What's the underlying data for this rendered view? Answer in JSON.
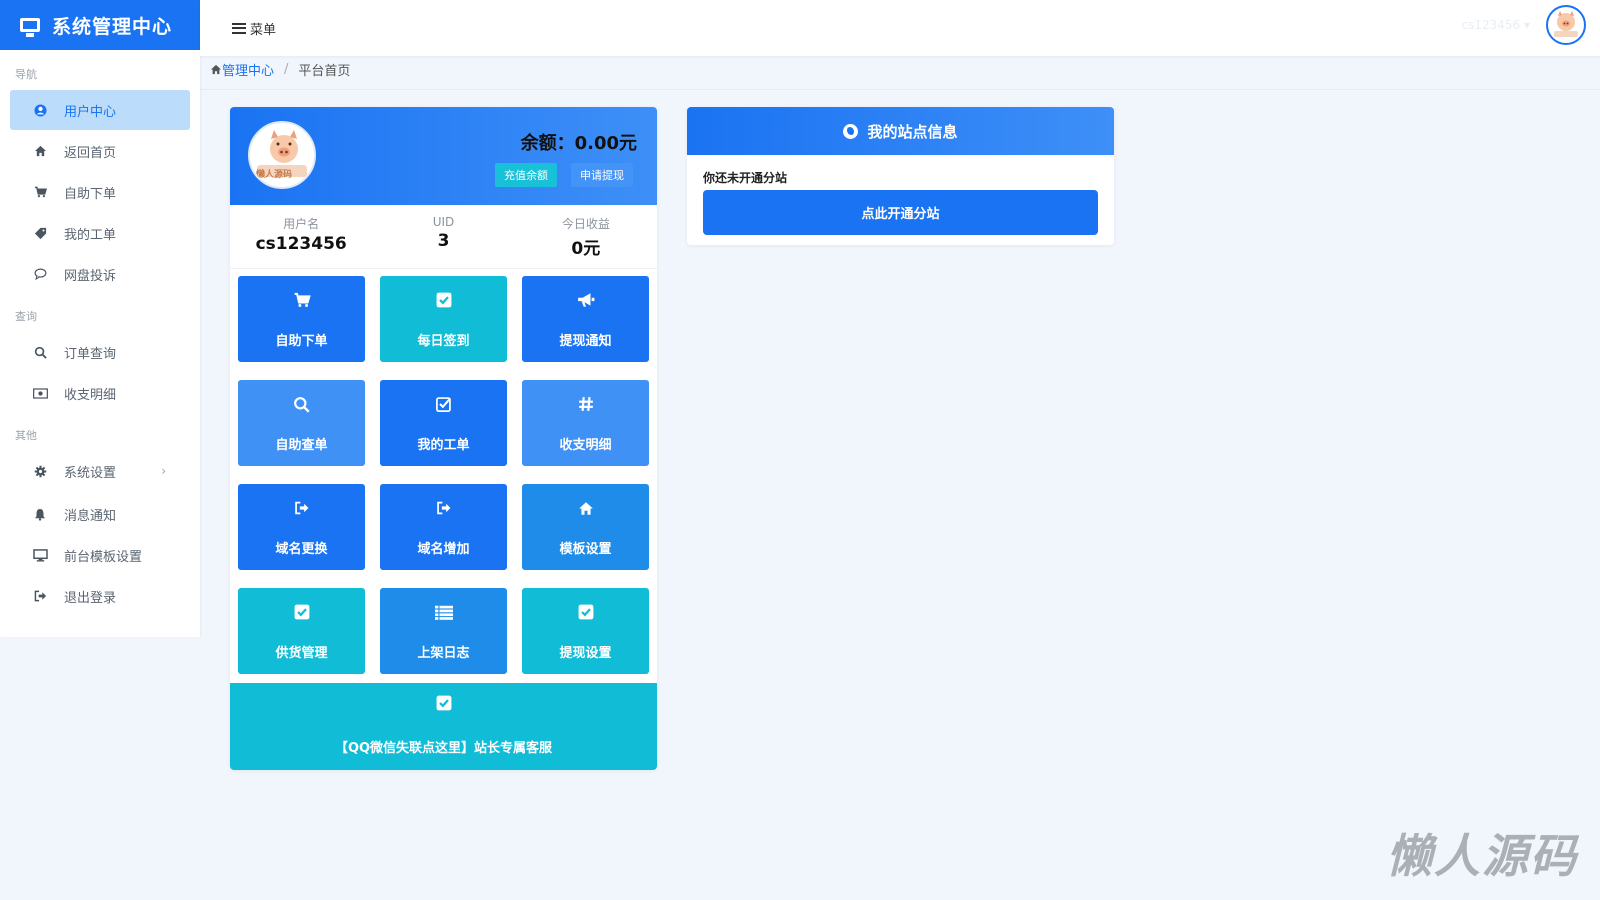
{
  "app": {
    "title": "系统管理中心"
  },
  "topbar": {
    "menu_label": "菜单",
    "username": "cs123456 ▾"
  },
  "sidebar": {
    "sections": [
      {
        "label": "导航",
        "items": [
          {
            "label": "用户中心",
            "icon": "user-circle-icon",
            "active": true
          },
          {
            "label": "返回首页",
            "icon": "home-icon"
          },
          {
            "label": "自助下单",
            "icon": "cart-icon"
          },
          {
            "label": "我的工单",
            "icon": "tag-icon"
          },
          {
            "label": "网盘投诉",
            "icon": "comment-icon"
          }
        ]
      },
      {
        "label": "查询",
        "items": [
          {
            "label": "订单查询",
            "icon": "search-icon"
          },
          {
            "label": "收支明细",
            "icon": "money-icon"
          }
        ]
      },
      {
        "label": "其他",
        "items": [
          {
            "label": "系统设置",
            "icon": "gear-icon",
            "arrow": "›"
          },
          {
            "label": "消息通知",
            "icon": "bell-icon"
          },
          {
            "label": "前台模板设置",
            "icon": "monitor-icon"
          },
          {
            "label": "退出登录",
            "icon": "logout-icon"
          }
        ]
      }
    ]
  },
  "breadcrumb": {
    "home": "管理中心",
    "sep": "/",
    "current": "平台首页"
  },
  "profile": {
    "avatar_text": "懒人源码",
    "balance": "余额：0.00元",
    "recharge_label": "充值余额",
    "withdraw_label": "申请提现",
    "stats": [
      {
        "label": "用户名",
        "value": "cs123456"
      },
      {
        "label": "UID",
        "value": "3"
      },
      {
        "label": "今日收益",
        "value": "0元"
      }
    ],
    "tiles": [
      {
        "label": "自助下单",
        "icon": "cart-icon",
        "color": "#1a73f2"
      },
      {
        "label": "每日签到",
        "icon": "check-square-icon",
        "color": "#11bcd6"
      },
      {
        "label": "提现通知",
        "icon": "bullhorn-icon",
        "color": "#1a73f2"
      },
      {
        "label": "自助查单",
        "icon": "search-icon",
        "color": "#3f91f6"
      },
      {
        "label": "我的工单",
        "icon": "edit-check-icon",
        "color": "#1a73f2"
      },
      {
        "label": "收支明细",
        "icon": "hashtag-icon",
        "color": "#3f91f6"
      },
      {
        "label": "域名更换",
        "icon": "sign-out-icon",
        "color": "#1a73f2"
      },
      {
        "label": "域名增加",
        "icon": "sign-out-icon",
        "color": "#1a73f2"
      },
      {
        "label": "模板设置",
        "icon": "home-icon",
        "color": "#1e8ce8"
      },
      {
        "label": "供货管理",
        "icon": "check-square-icon",
        "color": "#11bcd6"
      },
      {
        "label": "上架日志",
        "icon": "list-icon",
        "color": "#1e8ce8"
      },
      {
        "label": "提现设置",
        "icon": "check-square-icon",
        "color": "#11bcd6"
      }
    ],
    "service_label": "【QQ微信失联点这里】站长专属客服"
  },
  "site": {
    "title": "我的站点信息",
    "message": "你还未开通分站",
    "button": "点此开通分站"
  },
  "watermark": "懒人源码"
}
